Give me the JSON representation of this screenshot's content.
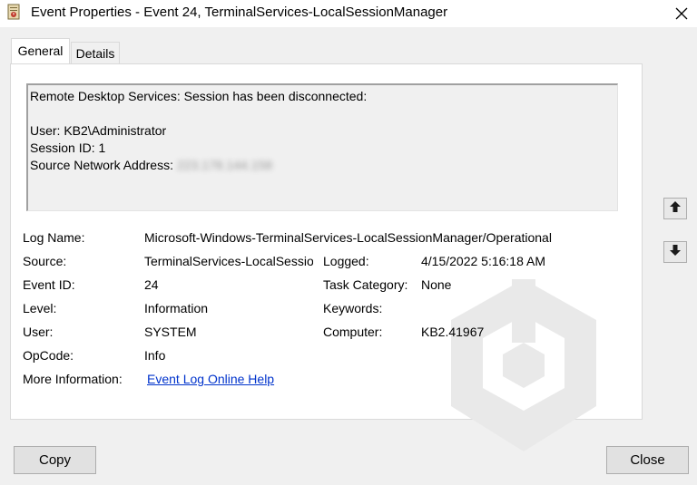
{
  "window": {
    "title": "Event Properties - Event 24, TerminalServices-LocalSessionManager"
  },
  "tabs": [
    {
      "label": "General",
      "selected": true
    },
    {
      "label": "Details",
      "selected": false
    }
  ],
  "description": {
    "line1": "Remote Desktop Services: Session has been disconnected:",
    "line2": "User: KB2\\Administrator",
    "line3": "Session ID: 1",
    "line4_label": "Source Network Address:",
    "line4_value": "223.178.144.158"
  },
  "fields": {
    "log_name": {
      "label": "Log Name:",
      "value": "Microsoft-Windows-TerminalServices-LocalSessionManager/Operational"
    },
    "source": {
      "label": "Source:",
      "value": "TerminalServices-LocalSessionManager"
    },
    "logged": {
      "label": "Logged:",
      "value": "4/15/2022 5:16:18 AM"
    },
    "event_id": {
      "label": "Event ID:",
      "value": "24"
    },
    "task_category": {
      "label": "Task Category:",
      "value": "None"
    },
    "level": {
      "label": "Level:",
      "value": "Information"
    },
    "keywords": {
      "label": "Keywords:",
      "value": ""
    },
    "user": {
      "label": "User:",
      "value": "SYSTEM"
    },
    "computer": {
      "label": "Computer:",
      "value": "KB2.41967"
    },
    "opcode": {
      "label": "OpCode:",
      "value": "Info"
    },
    "more_info": {
      "label": "More Information:",
      "value": "Event Log Online Help"
    }
  },
  "buttons": {
    "copy": "Copy",
    "close": "Close"
  },
  "icons": {
    "title": "event-log-icon",
    "close": "close-icon",
    "up": "arrow-up-icon",
    "down": "arrow-down-icon",
    "watermark": "logo-watermark"
  },
  "colors": {
    "link": "#0033cc",
    "dialog_bg": "#f0f0f0",
    "panel_bg": "#ffffff"
  }
}
